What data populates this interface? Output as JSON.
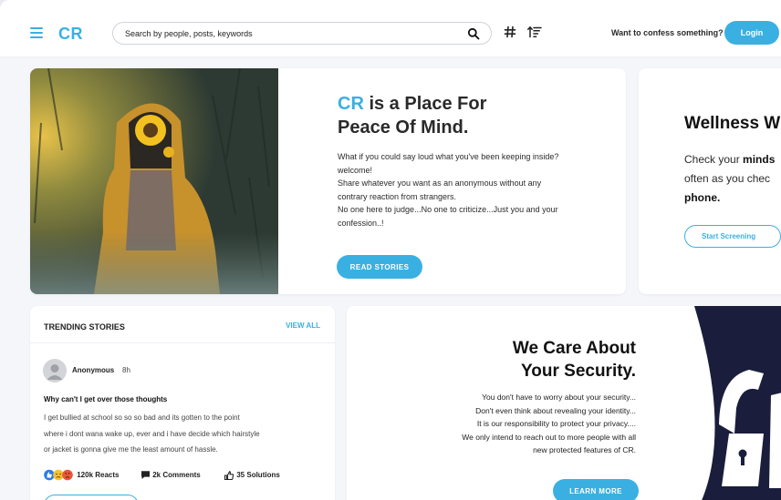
{
  "header": {
    "logo": "CR",
    "search_placeholder": "Search by people, posts, keywords",
    "confess_prompt": "Want to confess something?",
    "login_label": "Login"
  },
  "hero": {
    "title_accent": "CR",
    "title_rest": " is a Place For",
    "title_line2": "Peace Of Mind.",
    "body_lines": [
      "What if you could say loud what you've been keeping inside?",
      "welcome!",
      "Share whatever you want as an anonymous without any contrary reaction from strangers.",
      "No one here to judge...No one to criticize...Just you and your confession..!"
    ],
    "button_label": "READ STORIES"
  },
  "wellness": {
    "title": "Wellness W",
    "line1_pre": "Check your ",
    "line1_bold": "minds",
    "line2": "often as you chec",
    "line3_bold": "phone.",
    "button_label": "Start Screening"
  },
  "trending": {
    "heading": "TRENDING STORIES",
    "view_all": "VIEW ALL",
    "story": {
      "author": "Anonymous",
      "time": "8h",
      "title": "Why can't I get over those thoughts",
      "body_lines": [
        "I get bullied at school so so so bad and its gotten to the point",
        "where i dont wana wake up, ever and i have decide which hairstyle",
        "or jacket is gonna give me the least amount of hassle."
      ],
      "reacts": "120k Reacts",
      "comments": "2k Comments",
      "solutions": "35 Solutions"
    }
  },
  "security": {
    "title_line1": "We Care About",
    "title_line2": "Your Security.",
    "body_lines": [
      "You don't have to worry about your security...",
      "Don't even think about revealing your identity...",
      "It is our responsibility to protect your privacy....",
      "We only intend to reach out to more people with all",
      "new protected features of CR."
    ],
    "button_label": "LEARN MORE"
  },
  "colors": {
    "accent": "#3ab0e2",
    "navy": "#1b1d3c",
    "background": "#f4f6fa"
  }
}
